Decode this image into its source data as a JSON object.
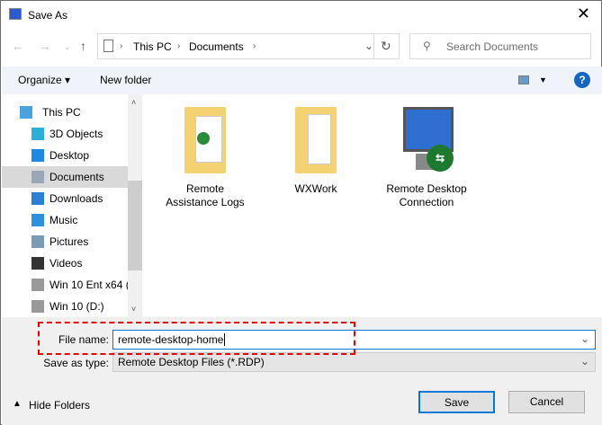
{
  "window": {
    "title": "Save As",
    "close": "✕"
  },
  "address": {
    "crumbs": [
      "This PC",
      "Documents"
    ],
    "search_placeholder": "Search Documents"
  },
  "toolbar": {
    "organize": "Organize ▾",
    "new_folder": "New folder",
    "help": "?"
  },
  "sidebar": {
    "items": [
      {
        "label": "This PC",
        "icon": "computer-icon",
        "color": "#4aa3df"
      },
      {
        "label": "3D Objects",
        "icon": "cube-icon",
        "color": "#2ab0d8"
      },
      {
        "label": "Desktop",
        "icon": "desktop-icon",
        "color": "#1e88e5"
      },
      {
        "label": "Documents",
        "icon": "document-icon",
        "color": "#9aa7b6"
      },
      {
        "label": "Downloads",
        "icon": "download-icon",
        "color": "#2c7fd6"
      },
      {
        "label": "Music",
        "icon": "music-icon",
        "color": "#2c90e0"
      },
      {
        "label": "Pictures",
        "icon": "pictures-icon",
        "color": "#7a9bb5"
      },
      {
        "label": "Videos",
        "icon": "videos-icon",
        "color": "#333"
      },
      {
        "label": "Win 10 Ent x64 (",
        "icon": "drive-icon",
        "color": "#999"
      },
      {
        "label": "Win 10 (D:)",
        "icon": "drive-icon",
        "color": "#999"
      }
    ],
    "selected": "Documents"
  },
  "files": [
    {
      "name": "Remote Assistance Logs",
      "icon": "folder-icon"
    },
    {
      "name": "WXWork",
      "icon": "folder-icon"
    },
    {
      "name": "Remote Desktop Connection",
      "icon": "remote-desktop-icon"
    }
  ],
  "form": {
    "file_name_label": "File name:",
    "file_name": "remote-desktop-home",
    "type_label": "Save as type:",
    "type": "Remote Desktop Files (*.RDP)"
  },
  "buttons": {
    "hide_folders": "Hide Folders",
    "save": "Save",
    "cancel": "Cancel"
  },
  "colors": {
    "accent": "#0078d7",
    "highlight": "#ee0000"
  }
}
